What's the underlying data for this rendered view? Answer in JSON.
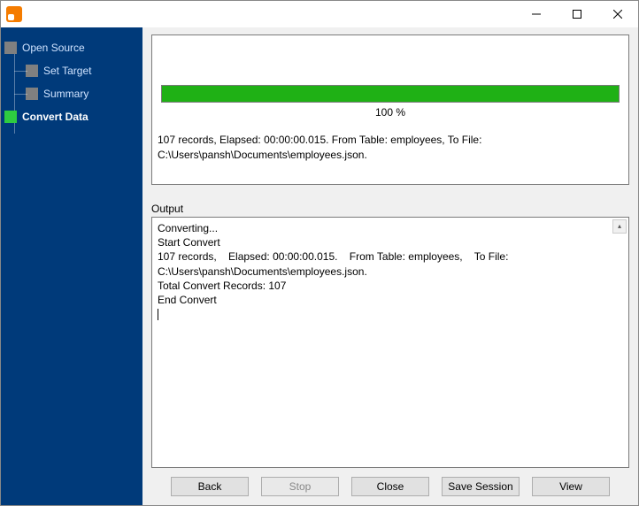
{
  "window": {},
  "sidebar": {
    "items": [
      {
        "label": "Open Source"
      },
      {
        "label": "Set Target"
      },
      {
        "label": "Summary"
      },
      {
        "label": "Convert Data"
      }
    ]
  },
  "progress": {
    "percent_text": "100 %"
  },
  "status_line": "107 records,    Elapsed: 00:00:00.015.    From Table: employees,    To File: C:\\Users\\pansh\\Documents\\employees.json.",
  "output": {
    "label": "Output",
    "log": "Converting...\nStart Convert\n107 records,    Elapsed: 00:00:00.015.    From Table: employees,    To File: C:\\Users\\pansh\\Documents\\employees.json.\nTotal Convert Records: 107\nEnd Convert"
  },
  "buttons": {
    "back": "Back",
    "stop": "Stop",
    "close": "Close",
    "save_session": "Save Session",
    "view": "View"
  }
}
